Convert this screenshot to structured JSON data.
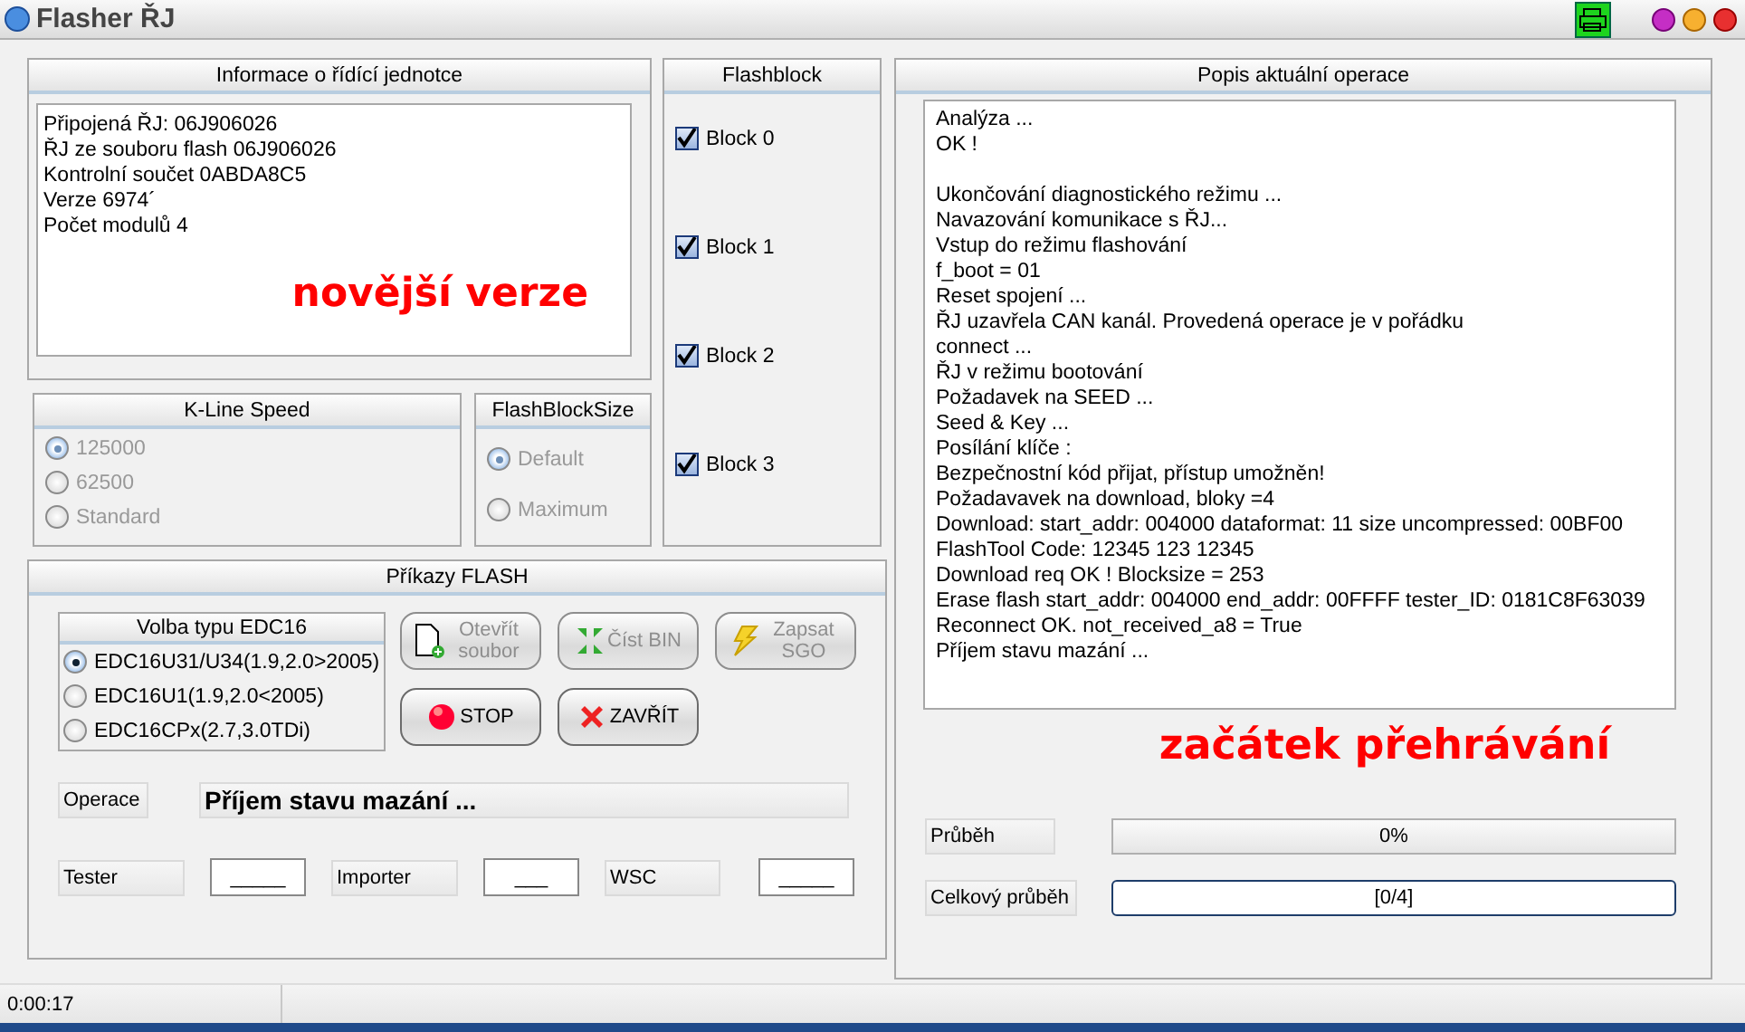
{
  "window": {
    "title": "Flasher ŘJ"
  },
  "ecu_info": {
    "title": "Informace o řídící jednotce",
    "lines": [
      "Připojená ŘJ: 06J906026",
      "ŘJ ze  souboru flash 06J906026",
      "Kontrolní součet 0ABDA8C5",
      "Verze 6974´",
      "Počet modulů 4"
    ],
    "annotation": "novější verze"
  },
  "flashblock": {
    "title": "Flashblock",
    "blocks": [
      {
        "label": "Block 0",
        "checked": true
      },
      {
        "label": "Block 1",
        "checked": true
      },
      {
        "label": "Block 2",
        "checked": true
      },
      {
        "label": "Block 3",
        "checked": true
      }
    ]
  },
  "kline_speed": {
    "title": "K-Line Speed",
    "disabled": true,
    "options": [
      {
        "label": "125000",
        "selected": true
      },
      {
        "label": "62500",
        "selected": false
      },
      {
        "label": "Standard",
        "selected": false
      }
    ]
  },
  "flash_block_size": {
    "title": "FlashBlockSize",
    "disabled": true,
    "options": [
      {
        "label": "Default",
        "selected": true
      },
      {
        "label": "Maximum",
        "selected": false
      }
    ]
  },
  "flash_commands": {
    "title": "Příkazy FLASH",
    "edc16_type": {
      "title": "Volba typu EDC16",
      "options": [
        {
          "label": "EDC16U31/U34(1.9,2.0>2005)",
          "selected": true
        },
        {
          "label": "EDC16U1(1.9,2.0<2005)",
          "selected": false
        },
        {
          "label": "EDC16CPx(2.7,3.0TDi)",
          "selected": false
        }
      ]
    },
    "buttons": [
      {
        "label": "Otevřít soubor",
        "kind": "open",
        "disabled": true
      },
      {
        "label": "Číst BIN",
        "kind": "read",
        "disabled": true
      },
      {
        "label": "Zapsat SGO",
        "kind": "write",
        "disabled": true
      },
      {
        "label": "STOP",
        "kind": "stop",
        "disabled": false
      },
      {
        "label": "ZAVŘÍT",
        "kind": "close",
        "disabled": false
      }
    ],
    "operation": {
      "label": "Operace",
      "value": "Příjem stavu mazání ..."
    },
    "fields": [
      {
        "label": "Tester",
        "value": "_____"
      },
      {
        "label": "Importer",
        "value": "___"
      },
      {
        "label": "WSC",
        "value": "_____"
      }
    ]
  },
  "operation_log": {
    "title": "Popis aktuální operace",
    "log_groups": [
      [
        "Analýza ...",
        "OK !"
      ],
      [
        "Ukončování diagnostického režimu ...",
        "Navazování komunikace s ŘJ...",
        "Vstup do režimu flashování",
        "f_boot = 01",
        "Reset spojení ...",
        "ŘJ uzavřela CAN kanál. Provedená operace je v pořádku",
        "connect ...",
        "ŘJ v režimu bootování",
        "Požadavek na SEED ...",
        "Seed & Key ...",
        "Posílání klíče :",
        "Bezpečnostní kód přijat, přístup umožněn!",
        "Požadavavek na download, bloky =4",
        "Download: start_addr: 004000 dataformat: 11 size uncompressed: 00BF00",
        "FlashTool Code: 12345 123 12345",
        "Download req OK ! Blocksize = 253",
        "Erase flash start_addr: 004000 end_addr: 00FFFF tester_ID: 0181C8F63039",
        "Reconnect OK. not_received_a8 = True",
        "Příjem stavu mazání ..."
      ]
    ],
    "annotation": "začátek přehrávání",
    "progress": [
      {
        "label": "Průběh",
        "reading": "0%",
        "focused": false
      },
      {
        "label": "Celkový průběh",
        "reading": "[0/4]",
        "focused": true
      }
    ]
  },
  "status_bar": {
    "time": "0:00:17"
  }
}
